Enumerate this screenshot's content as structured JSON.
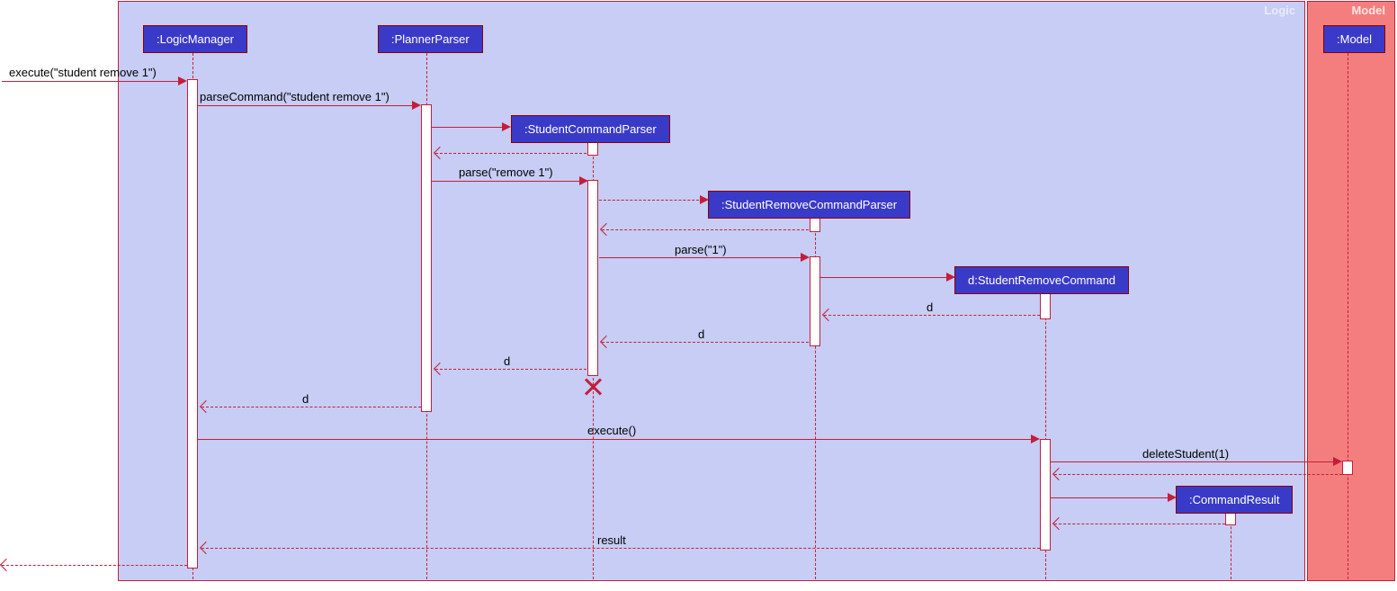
{
  "regions": {
    "logic": {
      "title": "Logic",
      "color_bg": "#c7cdf4",
      "color_title": "#e8ebfa"
    },
    "model": {
      "title": "Model",
      "color_bg": "#f47e7e",
      "color_title": "#fce5e5"
    }
  },
  "participants": {
    "logicManager": ":LogicManager",
    "plannerParser": ":PlannerParser",
    "studentCommandParser": ":StudentCommandParser",
    "studentRemoveCommandParser": ":StudentRemoveCommandParser",
    "studentRemoveCommand": "d:StudentRemoveCommand",
    "commandResult": ":CommandResult",
    "model": ":Model"
  },
  "messages": {
    "m1": "execute(\"student remove 1\")",
    "m2": "parseCommand(\"student remove 1\")",
    "m3": "parse(\"remove 1\")",
    "m4": "parse(\"1\")",
    "r_d1": "d",
    "r_d2": "d",
    "r_d3": "d",
    "r_d4": "d",
    "m5": "execute()",
    "m6": "deleteStudent(1)",
    "r_result": "result"
  },
  "chart_data": {
    "type": "sequence-diagram",
    "regions": [
      {
        "name": "Logic",
        "color": "#c7cdf4",
        "participants": [
          "LogicManager",
          "PlannerParser",
          "StudentCommandParser",
          "StudentRemoveCommandParser",
          "StudentRemoveCommand",
          "CommandResult"
        ]
      },
      {
        "name": "Model",
        "color": "#f47e7e",
        "participants": [
          "Model"
        ]
      }
    ],
    "participants": [
      {
        "id": "LogicManager",
        "label": ":LogicManager"
      },
      {
        "id": "PlannerParser",
        "label": ":PlannerParser"
      },
      {
        "id": "StudentCommandParser",
        "label": ":StudentCommandParser",
        "created": true,
        "destroyed": true
      },
      {
        "id": "StudentRemoveCommandParser",
        "label": ":StudentRemoveCommandParser",
        "created": true
      },
      {
        "id": "StudentRemoveCommand",
        "label": "d:StudentRemoveCommand",
        "created": true
      },
      {
        "id": "CommandResult",
        "label": ":CommandResult",
        "created": true
      },
      {
        "id": "Model",
        "label": ":Model"
      }
    ],
    "messages": [
      {
        "from": "external",
        "to": "LogicManager",
        "label": "execute(\"student remove 1\")",
        "type": "sync"
      },
      {
        "from": "LogicManager",
        "to": "PlannerParser",
        "label": "parseCommand(\"student remove 1\")",
        "type": "sync"
      },
      {
        "from": "PlannerParser",
        "to": "StudentCommandParser",
        "label": "",
        "type": "create"
      },
      {
        "from": "StudentCommandParser",
        "to": "PlannerParser",
        "label": "",
        "type": "return"
      },
      {
        "from": "PlannerParser",
        "to": "StudentCommandParser",
        "label": "parse(\"remove 1\")",
        "type": "sync"
      },
      {
        "from": "StudentCommandParser",
        "to": "StudentRemoveCommandParser",
        "label": "",
        "type": "create"
      },
      {
        "from": "StudentRemoveCommandParser",
        "to": "StudentCommandParser",
        "label": "",
        "type": "return"
      },
      {
        "from": "StudentCommandParser",
        "to": "StudentRemoveCommandParser",
        "label": "parse(\"1\")",
        "type": "sync"
      },
      {
        "from": "StudentRemoveCommandParser",
        "to": "StudentRemoveCommand",
        "label": "",
        "type": "create"
      },
      {
        "from": "StudentRemoveCommand",
        "to": "StudentRemoveCommandParser",
        "label": "d",
        "type": "return"
      },
      {
        "from": "StudentRemoveCommandParser",
        "to": "StudentCommandParser",
        "label": "d",
        "type": "return"
      },
      {
        "from": "StudentCommandParser",
        "to": "PlannerParser",
        "label": "d",
        "type": "return"
      },
      {
        "from": "StudentCommandParser",
        "to": null,
        "label": "",
        "type": "destroy"
      },
      {
        "from": "PlannerParser",
        "to": "LogicManager",
        "label": "d",
        "type": "return"
      },
      {
        "from": "LogicManager",
        "to": "StudentRemoveCommand",
        "label": "execute()",
        "type": "sync"
      },
      {
        "from": "StudentRemoveCommand",
        "to": "Model",
        "label": "deleteStudent(1)",
        "type": "sync"
      },
      {
        "from": "Model",
        "to": "StudentRemoveCommand",
        "label": "",
        "type": "return"
      },
      {
        "from": "StudentRemoveCommand",
        "to": "CommandResult",
        "label": "",
        "type": "create"
      },
      {
        "from": "CommandResult",
        "to": "StudentRemoveCommand",
        "label": "",
        "type": "return"
      },
      {
        "from": "StudentRemoveCommand",
        "to": "LogicManager",
        "label": "result",
        "type": "return"
      },
      {
        "from": "LogicManager",
        "to": "external",
        "label": "",
        "type": "return"
      }
    ]
  }
}
